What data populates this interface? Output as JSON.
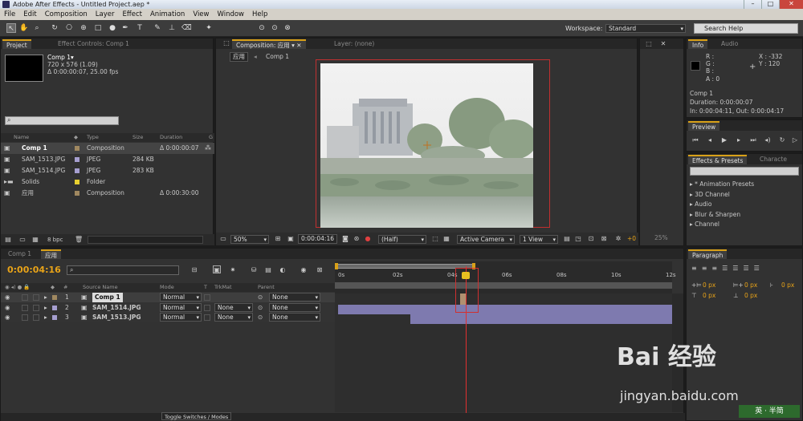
{
  "window": {
    "title": "Adobe After Effects - Untitled Project.aep *"
  },
  "menu": [
    "File",
    "Edit",
    "Composition",
    "Layer",
    "Effect",
    "Animation",
    "View",
    "Window",
    "Help"
  ],
  "toolbar": {
    "workspace_label": "Workspace:",
    "workspace_value": "Standard",
    "search_placeholder": "Search Help"
  },
  "project": {
    "tabs": [
      "Project",
      "Effect Controls: Comp 1"
    ],
    "selected_name": "Comp 1▾",
    "selected_dims": "720 x 576 (1.09)",
    "selected_duration": "Δ 0:00:00:07, 25.00 fps",
    "columns": [
      "Name",
      "Type",
      "Size",
      "Duration",
      "G"
    ],
    "items": [
      {
        "name": "Comp 1",
        "type": "Composition",
        "size": "",
        "duration": "Δ 0:00:00:07",
        "color": "#a08860"
      },
      {
        "name": "SAM_1513.JPG",
        "type": "JPEG",
        "size": "284 KB",
        "duration": "",
        "color": "#a69fd0"
      },
      {
        "name": "SAM_1514.JPG",
        "type": "JPEG",
        "size": "283 KB",
        "duration": "",
        "color": "#a69fd0"
      },
      {
        "name": "Solids",
        "type": "Folder",
        "size": "",
        "duration": "",
        "color": "#e8d030"
      },
      {
        "name": "应用",
        "type": "Composition",
        "size": "",
        "duration": "Δ 0:00:30:00",
        "color": "#a08860"
      }
    ],
    "bpc": "8 bpc"
  },
  "composition": {
    "tab_label": "Composition: 应用",
    "layer_tab": "Layer: (none)",
    "crumb_active": "应用",
    "crumb_next": "Comp 1",
    "zoom": "50%",
    "timecode": "0:00:04:16",
    "resolution": "(Half)",
    "camera": "Active Camera",
    "view": "1 View",
    "exposure": "+0",
    "zoom_right": "25%"
  },
  "info": {
    "tabs": [
      "Info",
      "Audio"
    ],
    "r": "R :",
    "g": "G :",
    "b": "B :",
    "a": "A : 0",
    "x": "X : -332",
    "y": "Y : 120",
    "comp_name": "Comp 1",
    "duration": "Duration: 0:00:00:07",
    "in_out": "In: 0:00:04:11, Out: 0:00:04:17"
  },
  "preview": {
    "title": "Preview"
  },
  "effects": {
    "tabs": [
      "Effects & Presets",
      "Characte"
    ],
    "items": [
      "* Animation Presets",
      "3D Channel",
      "Audio",
      "Blur & Sharpen",
      "Channel"
    ]
  },
  "paragraph": {
    "title": "Paragraph",
    "values": [
      "0 px",
      "0 px",
      "0 px",
      "0 px",
      "0 px"
    ]
  },
  "timeline": {
    "tabs": [
      "Comp 1",
      "应用"
    ],
    "timecode": "0:00:04:16",
    "columns": [
      "#",
      "Source Name",
      "Mode",
      "T",
      "TrkMat",
      "Parent"
    ],
    "layers": [
      {
        "num": "1",
        "name": "Comp 1",
        "mode": "Normal",
        "trkmat": "",
        "parent": "None",
        "color": "#a08860"
      },
      {
        "num": "2",
        "name": "SAM_1514.JPG",
        "mode": "Normal",
        "trkmat": "None",
        "parent": "None",
        "color": "#a69fd0"
      },
      {
        "num": "3",
        "name": "SAM_1513.JPG",
        "mode": "Normal",
        "trkmat": "None",
        "parent": "None",
        "color": "#a69fd0"
      }
    ],
    "ruler": [
      "0s",
      "02s",
      "04s",
      "06s",
      "08s",
      "10s",
      "12s"
    ],
    "toggle_label": "Toggle Switches / Modes"
  },
  "watermark": {
    "brand": "Bai 经验",
    "url": "jingyan.baidu.com",
    "corner": "英 · 半简"
  }
}
